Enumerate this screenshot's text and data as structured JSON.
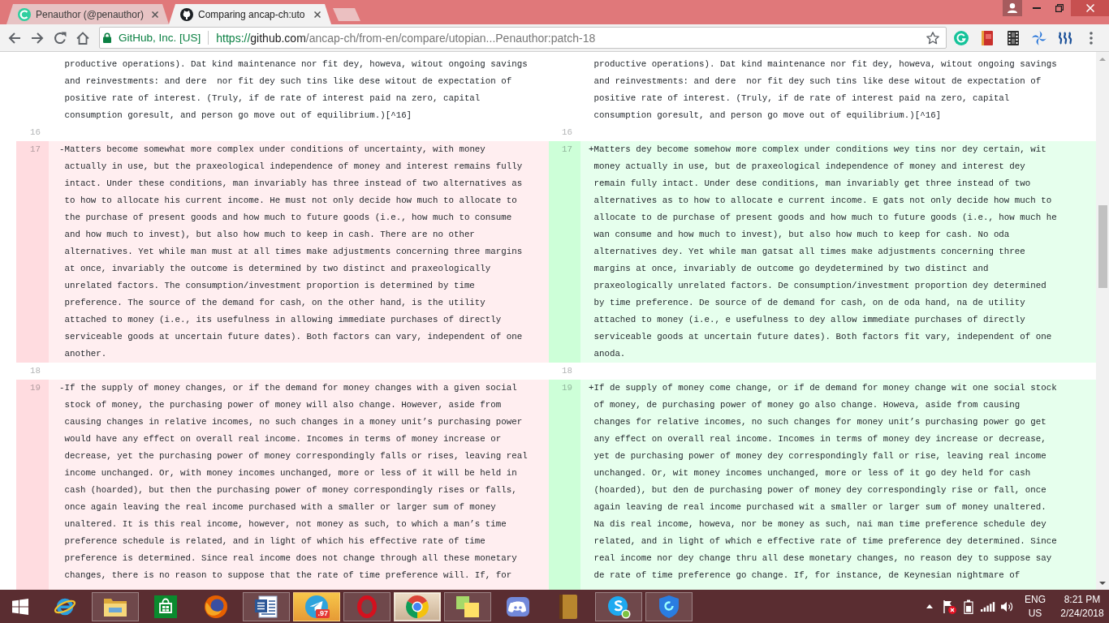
{
  "browser": {
    "tabs": [
      {
        "title": "Penauthor (@penauthor)",
        "selected": false
      },
      {
        "title": "Comparing ancap-ch:uto",
        "selected": true
      }
    ],
    "address_bar": {
      "security_label": "GitHub, Inc. [US]",
      "url_scheme": "https://",
      "url_host": "github.com",
      "url_path": "/ancap-ch/from-en/compare/utopian...Penauthor:patch-18"
    }
  },
  "diff": {
    "rows": [
      {
        "left": {
          "kind": "context",
          "lines": [
            "productive operations). Dat kind maintenance nor fit dey, howeva, witout ongoing savings",
            "and reinvestments: and dere  nor fit dey such tins like dese witout de expectation of",
            "positive rate of interest. (Truly, if de rate of interest paid na zero, capital",
            "consumption goresult, and person go move out of equilibrium.)[^16]"
          ]
        },
        "right": {
          "kind": "context",
          "lines": [
            "productive operations). Dat kind maintenance nor fit dey, howeva, witout ongoing savings",
            "and reinvestments: and dere  nor fit dey such tins like dese witout de expectation of",
            "positive rate of interest. (Truly, if de rate of interest paid na zero, capital",
            "consumption goresult, and person go move out of equilibrium.)[^16]"
          ]
        }
      },
      {
        "left": {
          "kind": "context",
          "number": "16"
        },
        "right": {
          "kind": "context",
          "number": "16"
        }
      },
      {
        "left": {
          "kind": "deletion",
          "number": "17",
          "lines": [
            "-Matters become somewhat more complex under conditions of uncertainty, with money",
            "actually in use, but the praxeological independence of money and interest remains fully",
            "intact. Under these conditions, man invariably has three instead of two alternatives as",
            "to how to allocate his current income. He must not only decide how much to allocate to",
            "the purchase of present goods and how much to future goods (i.e., how much to consume",
            "and how much to invest), but also how much to keep in cash. There are no other",
            "alternatives. Yet while man must at all times make adjustments concerning three margins",
            "at once, invariably the outcome is determined by two distinct and praxeologically",
            "unrelated factors. The consumption/investment proportion is determined by time",
            "preference. The source of the demand for cash, on the other hand, is the utility",
            "attached to money (i.e., its usefulness in allowing immediate purchases of directly",
            "serviceable goods at uncertain future dates). Both factors can vary, independent of one",
            "another."
          ]
        },
        "right": {
          "kind": "addition",
          "number": "17",
          "lines": [
            "+Matters dey become somehow more complex under conditions wey tins nor dey certain, wit",
            "money actually in use, but de praxeological independence of money and interest dey",
            "remain fully intact. Under dese conditions, man invariably get three instead of two",
            "alternatives as to how to allocate e current income. E gats not only decide how much to",
            "allocate to de purchase of present goods and how much to future goods (i.e., how much he",
            "wan consume and how much to invest), but also how much to keep for cash. No oda",
            "alternatives dey. Yet while man gatsat all times make adjustments concerning three",
            "margins at once, invariably de outcome go deydetermined by two distinct and",
            "praxeologically unrelated factors. De consumption/investment proportion dey determined",
            "by time preference. De source of de demand for cash, on de oda hand, na de utility",
            "attached to money (i.e., e usefulness to dey allow immediate purchases of directly",
            "serviceable goods at uncertain future dates). Both factors fit vary, independent of one",
            "anoda."
          ]
        }
      },
      {
        "left": {
          "kind": "context",
          "number": "18"
        },
        "right": {
          "kind": "context",
          "number": "18"
        }
      },
      {
        "left": {
          "kind": "deletion",
          "number": "19",
          "lines": [
            "-If the supply of money changes, or if the demand for money changes with a given social",
            "stock of money, the purchasing power of money will also change. However, aside from",
            "causing changes in relative incomes, no such changes in a money unit’s purchasing power",
            "would have any effect on overall real income. Incomes in terms of money increase or",
            "decrease, yet the purchasing power of money correspondingly falls or rises, leaving real",
            "income unchanged. Or, with money incomes unchanged, more or less of it will be held in",
            "cash (hoarded), but then the purchasing power of money correspondingly rises or falls,",
            "once again leaving the real income purchased with a smaller or larger sum of money",
            "unaltered. It is this real income, however, not money as such, to which a man’s time",
            "preference schedule is related, and in light of which his effective rate of time",
            "preference is determined. Since real income does not change through all these monetary",
            "changes, there is no reason to suppose that the rate of time preference will. If, for"
          ]
        },
        "right": {
          "kind": "addition",
          "number": "19",
          "lines": [
            "+If de supply of money come change, or if de demand for money change wit one social stock",
            "of money, de purchasing power of money go also change. Howeva, aside from causing",
            "changes for relative incomes, no such changes for money unit’s purchasing power go get",
            "any effect on overall real income. Incomes in terms of money dey increase or decrease,",
            "yet de purchasing power of money dey correspondingly fall or rise, leaving real income",
            "unchanged. Or, wit money incomes unchanged, more or less of it go dey held for cash",
            "(hoarded), but den de purchasing power of money dey correspondingly rise or fall, once",
            "again leaving de real income purchased wit a smaller or larger sum of money unaltered.",
            "Na dis real income, howeva, nor be money as such, nai man time preference schedule dey",
            "related, and in light of which e effective rate of time preference dey determined. Since",
            "real income nor dey change thru all dese monetary changes, no reason dey to suppose say",
            "de rate of time preference go change. If, for instance, de Keynesian nightmare of"
          ]
        }
      }
    ]
  },
  "taskbar": {
    "apps": [
      {
        "running": false,
        "selected": false,
        "attention": false
      },
      {
        "running": true,
        "selected": false,
        "attention": false
      },
      {
        "running": false,
        "selected": false,
        "attention": false
      },
      {
        "running": false,
        "selected": false,
        "attention": false
      },
      {
        "running": true,
        "selected": false,
        "attention": false
      },
      {
        "running": true,
        "selected": false,
        "attention": true,
        "badge": ".97"
      },
      {
        "running": true,
        "selected": false,
        "attention": false
      },
      {
        "running": true,
        "selected": true,
        "attention": false
      },
      {
        "running": true,
        "selected": false,
        "attention": false
      },
      {
        "running": false,
        "selected": false,
        "attention": false
      },
      {
        "running": false,
        "selected": false,
        "attention": false
      },
      {
        "running": true,
        "selected": false,
        "attention": false
      },
      {
        "running": true,
        "selected": false,
        "attention": false
      }
    ],
    "tray": {
      "language": "ENG",
      "region": "US",
      "time": "8:21 PM",
      "date": "2/24/2018"
    }
  }
}
